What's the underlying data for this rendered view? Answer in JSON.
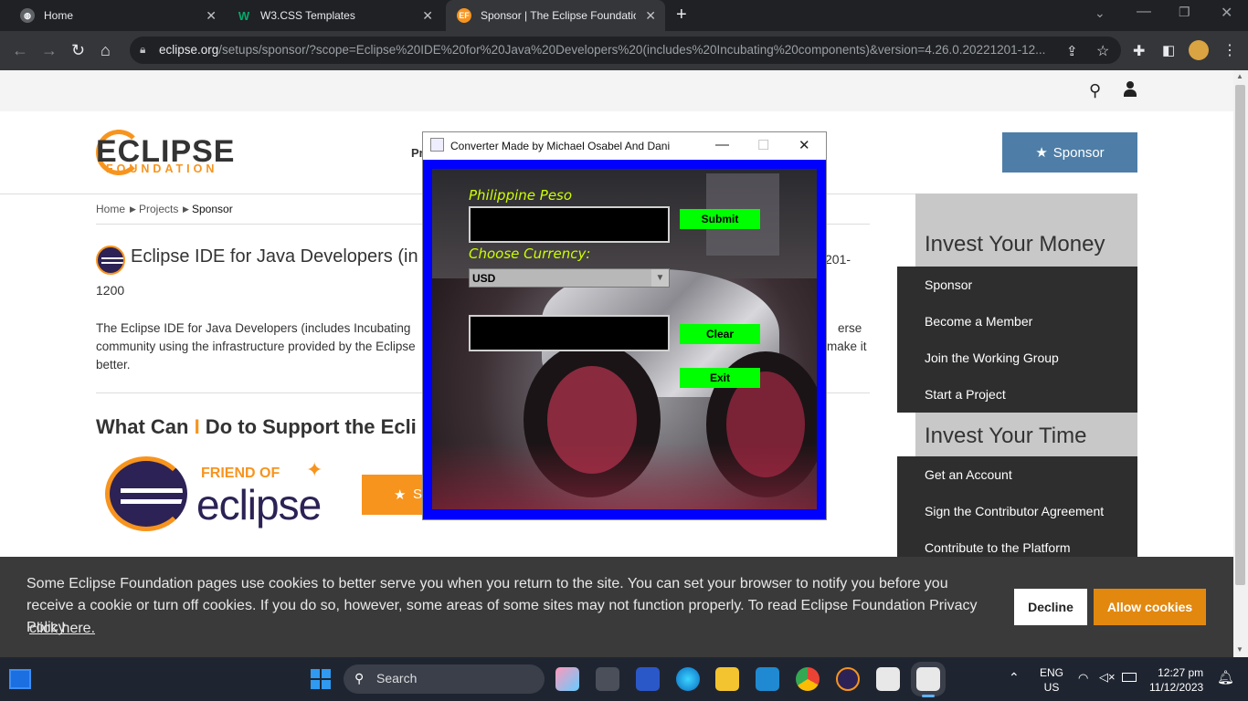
{
  "browser": {
    "tabs": [
      {
        "label": "Home",
        "icon": "globe-icon"
      },
      {
        "label": "W3.CSS Templates",
        "icon": "w3-icon"
      },
      {
        "label": "Sponsor | The Eclipse Foundation",
        "icon": "ef-icon"
      }
    ],
    "url_domain": "eclipse.org",
    "url_path": "/setups/sponsor/?scope=Eclipse%20IDE%20for%20Java%20Developers%20(includes%20Incubating%20components)&version=4.26.0.20221201-12..."
  },
  "site": {
    "logo_main": "ECLIPSE",
    "logo_sub": "FOUNDATION",
    "nav_partial": "Pr",
    "sponsor_button": "Sponsor",
    "breadcrumb": [
      "Home",
      "Projects",
      "Sponsor"
    ],
    "heading": "Eclipse IDE for Java Developers (in",
    "heading_tail": "201-",
    "heading_line2": "1200",
    "body_line1_a": "The Eclipse IDE for Java Developers (includes Incubating",
    "body_line1_b": "erse",
    "body_line2_a": "community using the infrastructure provided by the Eclipse",
    "body_line2_b": "make it",
    "body_line3": "better.",
    "support_heading_a": "What Can ",
    "support_heading_i": "I",
    "support_heading_b": " Do to Support the Ecli",
    "friend_of": "FRIEND OF",
    "friend_eclipse": "eclipse",
    "orange_button": "S"
  },
  "sidebar": {
    "money_title": "Invest Your Money",
    "money_items": [
      "Sponsor",
      "Become a Member",
      "Join the Working Group",
      "Start a Project"
    ],
    "time_title": "Invest Your Time",
    "time_items": [
      "Get an Account",
      "Sign the Contributor Agreement",
      "Contribute to the Platform"
    ]
  },
  "cookie": {
    "text": "Some Eclipse Foundation pages use cookies to better serve you when you return to the site. You can set your browser to notify you before you receive a cookie or turn off cookies. If you do so, however, some areas of some sites may not function properly. To read Eclipse Foundation Privacy Policy",
    "link": "click here.",
    "decline": "Decline",
    "allow": "Allow cookies"
  },
  "converter": {
    "title": "Converter Made by  Michael Osabel And Dani",
    "label_peso": "Philippine Peso",
    "label_currency": "Choose Currency:",
    "currency_selected": "USD",
    "submit": "Submit",
    "clear": "Clear",
    "exit": "Exit",
    "input_value": "",
    "output_value": ""
  },
  "taskbar": {
    "search": "Search",
    "lang_top": "ENG",
    "lang_bottom": "US",
    "time": "12:27 pm",
    "date": "11/12/2023"
  },
  "colors": {
    "frame_blue": "#0000ff",
    "button_green": "#00ff00",
    "label_yellow": "#ccff00",
    "eclipse_orange": "#f7941e",
    "sponsor_blue": "#4e7ea7"
  }
}
